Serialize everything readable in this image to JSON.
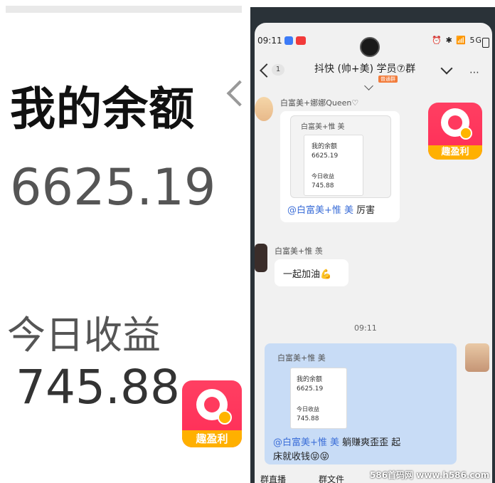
{
  "left_panel": {
    "title": "我的余额",
    "balance": "6625.19",
    "today_label": "今日收益",
    "today_value": "745.88"
  },
  "logo": {
    "text": "趣盈利",
    "brand_color": "#ff3a5e",
    "accent_color": "#ffb000"
  },
  "status_bar": {
    "time": "09:11",
    "icons": "⏰ ✱ 📶 5G"
  },
  "chat_header": {
    "unread": "1",
    "title": "抖快 (帅+美) 学员⑦群",
    "tag": "普通群",
    "more": "⋯"
  },
  "messages": {
    "m1": {
      "sender": "白富美+娜娜Queen♡",
      "quote_name": "白富美+惟 美",
      "quote_balance_label": "我的余额",
      "quote_balance": "6625.19",
      "quote_today_label": "今日收益",
      "quote_today": "745.88",
      "mention": "@白富美+惟 美",
      "text": "厉害"
    },
    "m2": {
      "sender": "白富美+惟 羡",
      "text": "一起加油💪"
    },
    "timestamp": "09:11",
    "m3": {
      "quote_name": "白富美+惟 美",
      "quote_balance_label": "我的余额",
      "quote_balance": "6625.19",
      "quote_today_label": "今日收益",
      "quote_today": "745.88",
      "mention": "@白富美+惟 美",
      "text_line1": "躺赚爽歪歪 起",
      "text_line2": "床就收钱😝😝"
    }
  },
  "bottom_bar": {
    "item1": "群直播",
    "item2": "群文件"
  },
  "watermark": "586首码网 www.h586.com"
}
